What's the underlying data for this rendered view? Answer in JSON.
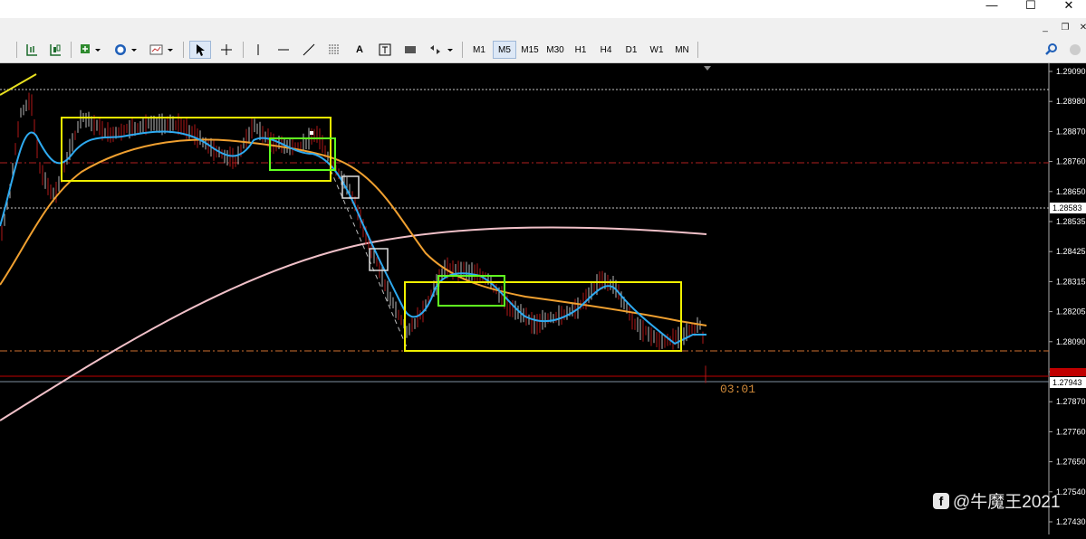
{
  "window": {
    "minimize": "—",
    "maximize": "☐",
    "close": "✕",
    "child_minimize": "_",
    "child_restore": "❐",
    "child_close": "✕"
  },
  "toolbar": {
    "timeframes": [
      "M1",
      "M5",
      "M15",
      "M30",
      "H1",
      "H4",
      "D1",
      "W1",
      "MN"
    ],
    "active_timeframe": "M5",
    "tools": {
      "cursor_icon": "cursor-icon",
      "crosshair_icon": "crosshair-icon",
      "vline_icon": "vertical-line-icon",
      "hline_icon": "horizontal-line-icon",
      "trendline_icon": "trendline-icon",
      "channel_icon": "channel-icon",
      "fib_icon": "fibonacci-icon",
      "text_label": "A",
      "textlabel_icon": "text-label-icon",
      "rect_icon": "rectangle-icon",
      "arrows_icon": "arrows-icon"
    },
    "search_icon": "search-icon"
  },
  "price_axis": {
    "labels": [
      "1.29090",
      "1.28980",
      "1.28870",
      "1.28760",
      "1.28650",
      "1.28535",
      "1.28425",
      "1.28315",
      "1.28205",
      "1.28090",
      "1.27980",
      "1.27870",
      "1.27760",
      "1.27650",
      "1.27540",
      "1.27430"
    ],
    "highlight_labels": [
      {
        "text": "1.28583",
        "kind": "level"
      },
      {
        "text": "1.27943",
        "kind": "bid"
      }
    ]
  },
  "countdown": "03:01",
  "watermark": {
    "icon": "f",
    "text": "@牛魔王2021"
  },
  "colors": {
    "background": "#000000",
    "candle_up": "#b8b8b8",
    "candle_down": "#b01818",
    "ema_fast": "#2eaaf0",
    "ema_slow": "#f0a030",
    "ma_long": "#f0c0c8",
    "box_yellow": "#f0f000",
    "box_green": "#60ff20",
    "resistance_line": "#b02020",
    "bid_line": "#c00000",
    "dashed_white": "#c8c8c8"
  }
}
